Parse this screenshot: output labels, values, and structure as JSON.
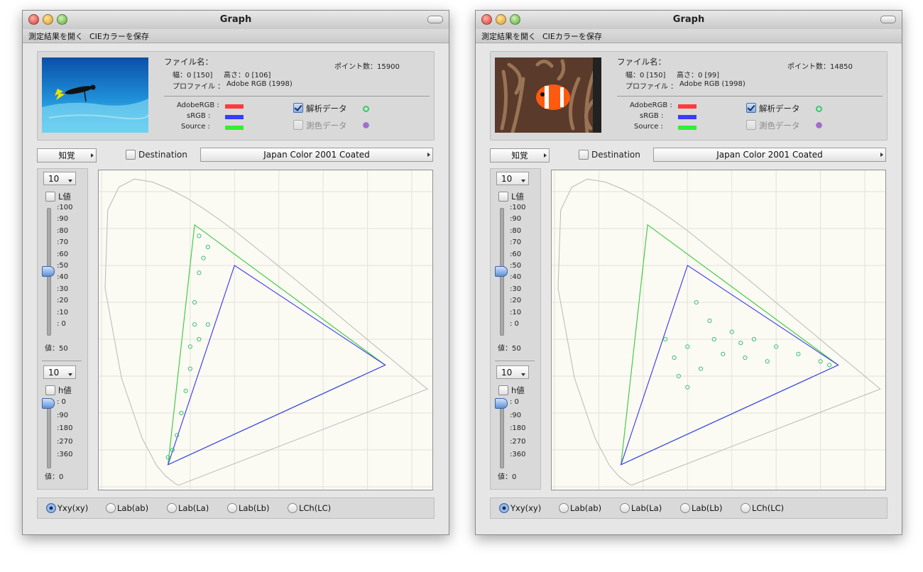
{
  "windows": [
    {
      "title": "Graph",
      "menu": [
        "測定結果を開く",
        "CIEカラーを保存"
      ],
      "thumbnail": "diver-underwater-photo",
      "file_name_label": "ファイル名：",
      "width_label": "幅：0 [150]",
      "height_label": "高さ：0 [106]",
      "profile_label": "プロファイル ：",
      "profile_value": "Adobe RGB (1998)",
      "points_label": "ポイント数：15900",
      "legend": [
        {
          "label": "AdobeRGB :",
          "color": "#ff3b3b"
        },
        {
          "label": "sRGB :",
          "color": "#3b3bff"
        },
        {
          "label": "Source :",
          "color": "#33ee33"
        }
      ],
      "analysis_label": "解析データ",
      "colorimetric_label": "測色データ",
      "intent": "知覚",
      "destination_label": "Destination",
      "destination_profile": "Japan Color 2001 Coated",
      "l_step": "10",
      "l_label": "L値",
      "l_ticks": [
        ":100",
        ":90",
        ":80",
        ":70",
        ":60",
        ":50",
        ":40",
        ":30",
        ":20",
        ":10",
        ": 0"
      ],
      "l_value_label": "値：50",
      "l_value": 50,
      "h_step": "10",
      "h_label": "h値",
      "h_ticks": [
        ": 0",
        ":90",
        ":180",
        ":270",
        ":360"
      ],
      "h_value_label": "値：0",
      "h_value": 0,
      "modes": [
        "Yxy(xy)",
        "Lab(ab)",
        "Lab(La)",
        "Lab(Lb)",
        "LCh(LC)"
      ],
      "selected_mode": 0
    },
    {
      "title": "Graph",
      "menu": [
        "測定結果を開く",
        "CIEカラーを保存"
      ],
      "thumbnail": "clownfish-anemone-photo",
      "file_name_label": "ファイル名：",
      "width_label": "幅：0 [150]",
      "height_label": "高さ：0 [99]",
      "profile_label": "プロファイル ：",
      "profile_value": "Adobe RGB (1998)",
      "points_label": "ポイント数：14850",
      "legend": [
        {
          "label": "AdobeRGB :",
          "color": "#ff3b3b"
        },
        {
          "label": "sRGB :",
          "color": "#3b3bff"
        },
        {
          "label": "Source :",
          "color": "#33ee33"
        }
      ],
      "analysis_label": "解析データ",
      "colorimetric_label": "測色データ",
      "intent": "知覚",
      "destination_label": "Destination",
      "destination_profile": "Japan Color 2001 Coated",
      "l_step": "10",
      "l_label": "L値",
      "l_ticks": [
        ":100",
        ":90",
        ":80",
        ":70",
        ":60",
        ":50",
        ":40",
        ":30",
        ":20",
        ":10",
        ": 0"
      ],
      "l_value_label": "値：50",
      "l_value": 50,
      "h_step": "10",
      "h_label": "h値",
      "h_ticks": [
        ": 0",
        ":90",
        ":180",
        ":270",
        ":360"
      ],
      "h_value_label": "値：0",
      "h_value": 0,
      "modes": [
        "Yxy(xy)",
        "Lab(ab)",
        "Lab(La)",
        "Lab(Lb)",
        "LCh(LC)"
      ],
      "selected_mode": 0
    }
  ],
  "colors": {
    "analysis_dot": "#33cc66",
    "colorimetric_dot": "#b066c8",
    "point_color": "#3fbf78",
    "grid": "#e2e2da",
    "locus": "#b8b8b8",
    "adobe_gamut": "#44cc44",
    "srgb_gamut": "#4444ee"
  },
  "chart_data": [
    {
      "type": "scatter",
      "description_axes": "CIE xy",
      "gamuts": {
        "adobe_rgb": [
          [
            0.64,
            0.33
          ],
          [
            0.21,
            0.71
          ],
          [
            0.15,
            0.06
          ]
        ],
        "srgb": [
          [
            0.64,
            0.33
          ],
          [
            0.3,
            0.6
          ],
          [
            0.15,
            0.06
          ]
        ]
      },
      "source_points": [
        [
          0.22,
          0.68
        ],
        [
          0.24,
          0.65
        ],
        [
          0.23,
          0.62
        ],
        [
          0.22,
          0.58
        ],
        [
          0.21,
          0.5
        ],
        [
          0.21,
          0.44
        ],
        [
          0.2,
          0.38
        ],
        [
          0.2,
          0.32
        ],
        [
          0.19,
          0.26
        ],
        [
          0.18,
          0.2
        ],
        [
          0.17,
          0.14
        ],
        [
          0.16,
          0.1
        ],
        [
          0.15,
          0.08
        ],
        [
          0.24,
          0.44
        ],
        [
          0.22,
          0.4
        ]
      ]
    },
    {
      "type": "scatter",
      "description_axes": "CIE xy",
      "gamuts": {
        "adobe_rgb": [
          [
            0.64,
            0.33
          ],
          [
            0.21,
            0.71
          ],
          [
            0.15,
            0.06
          ]
        ],
        "srgb": [
          [
            0.64,
            0.33
          ],
          [
            0.3,
            0.6
          ],
          [
            0.15,
            0.06
          ]
        ]
      },
      "source_points": [
        [
          0.32,
          0.5
        ],
        [
          0.35,
          0.45
        ],
        [
          0.4,
          0.42
        ],
        [
          0.45,
          0.4
        ],
        [
          0.5,
          0.38
        ],
        [
          0.55,
          0.36
        ],
        [
          0.6,
          0.34
        ],
        [
          0.62,
          0.33
        ],
        [
          0.25,
          0.4
        ],
        [
          0.27,
          0.35
        ],
        [
          0.28,
          0.3
        ],
        [
          0.3,
          0.27
        ],
        [
          0.33,
          0.32
        ],
        [
          0.38,
          0.36
        ],
        [
          0.43,
          0.35
        ],
        [
          0.48,
          0.34
        ],
        [
          0.3,
          0.38
        ],
        [
          0.36,
          0.4
        ],
        [
          0.42,
          0.39
        ]
      ]
    }
  ]
}
